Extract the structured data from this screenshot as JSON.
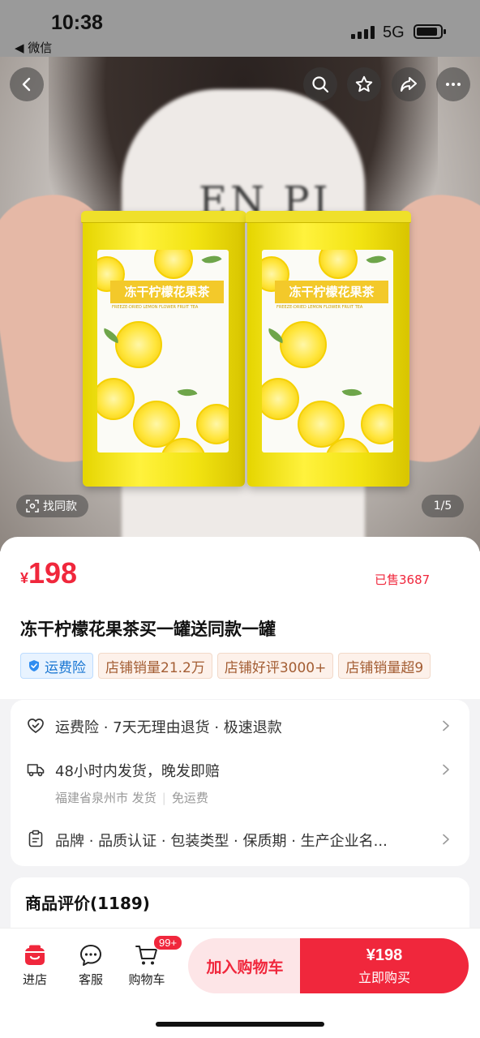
{
  "status_bar": {
    "time": "10:38",
    "back_app": "◀ 微信",
    "network": "5G",
    "battery_level": 0.9
  },
  "gallery": {
    "find_same_label": "找同款",
    "pager": "1/5",
    "product_label_title": "冻干柠檬花果茶",
    "product_label_sub": "FREEZE-DRIED LEMON FLOWER FRUIT TEA"
  },
  "product": {
    "currency": "¥",
    "price": "198",
    "sold": "已售3687",
    "title": "冻干柠檬花果茶买一罐送同款一罐",
    "tags": [
      "运费险",
      "店铺销量21.2万",
      "店铺好评3000+",
      "店铺销量超9"
    ]
  },
  "services": [
    {
      "icon": "heart-shield-icon",
      "text": "运费险 · 7天无理由退货 · 极速退款"
    },
    {
      "icon": "truck-icon",
      "text": "48小时内发货，晚发即赔",
      "sub": "福建省泉州市 发货",
      "sub2": "免运费"
    },
    {
      "icon": "clipboard-icon",
      "text": "品牌 · 品质认证 · 包装类型 · 保质期 · 生产企业名..."
    }
  ],
  "reviews": {
    "title": "商品评价(1189)"
  },
  "bottom_bar": {
    "shop": "进店",
    "service": "客服",
    "cart": "购物车",
    "cart_badge": "99+",
    "add_to_cart": "加入购物车",
    "buy_price": "¥198",
    "buy_now": "立即购买"
  },
  "colors": {
    "accent": "#f0273c",
    "insurance": "#1976d2"
  }
}
